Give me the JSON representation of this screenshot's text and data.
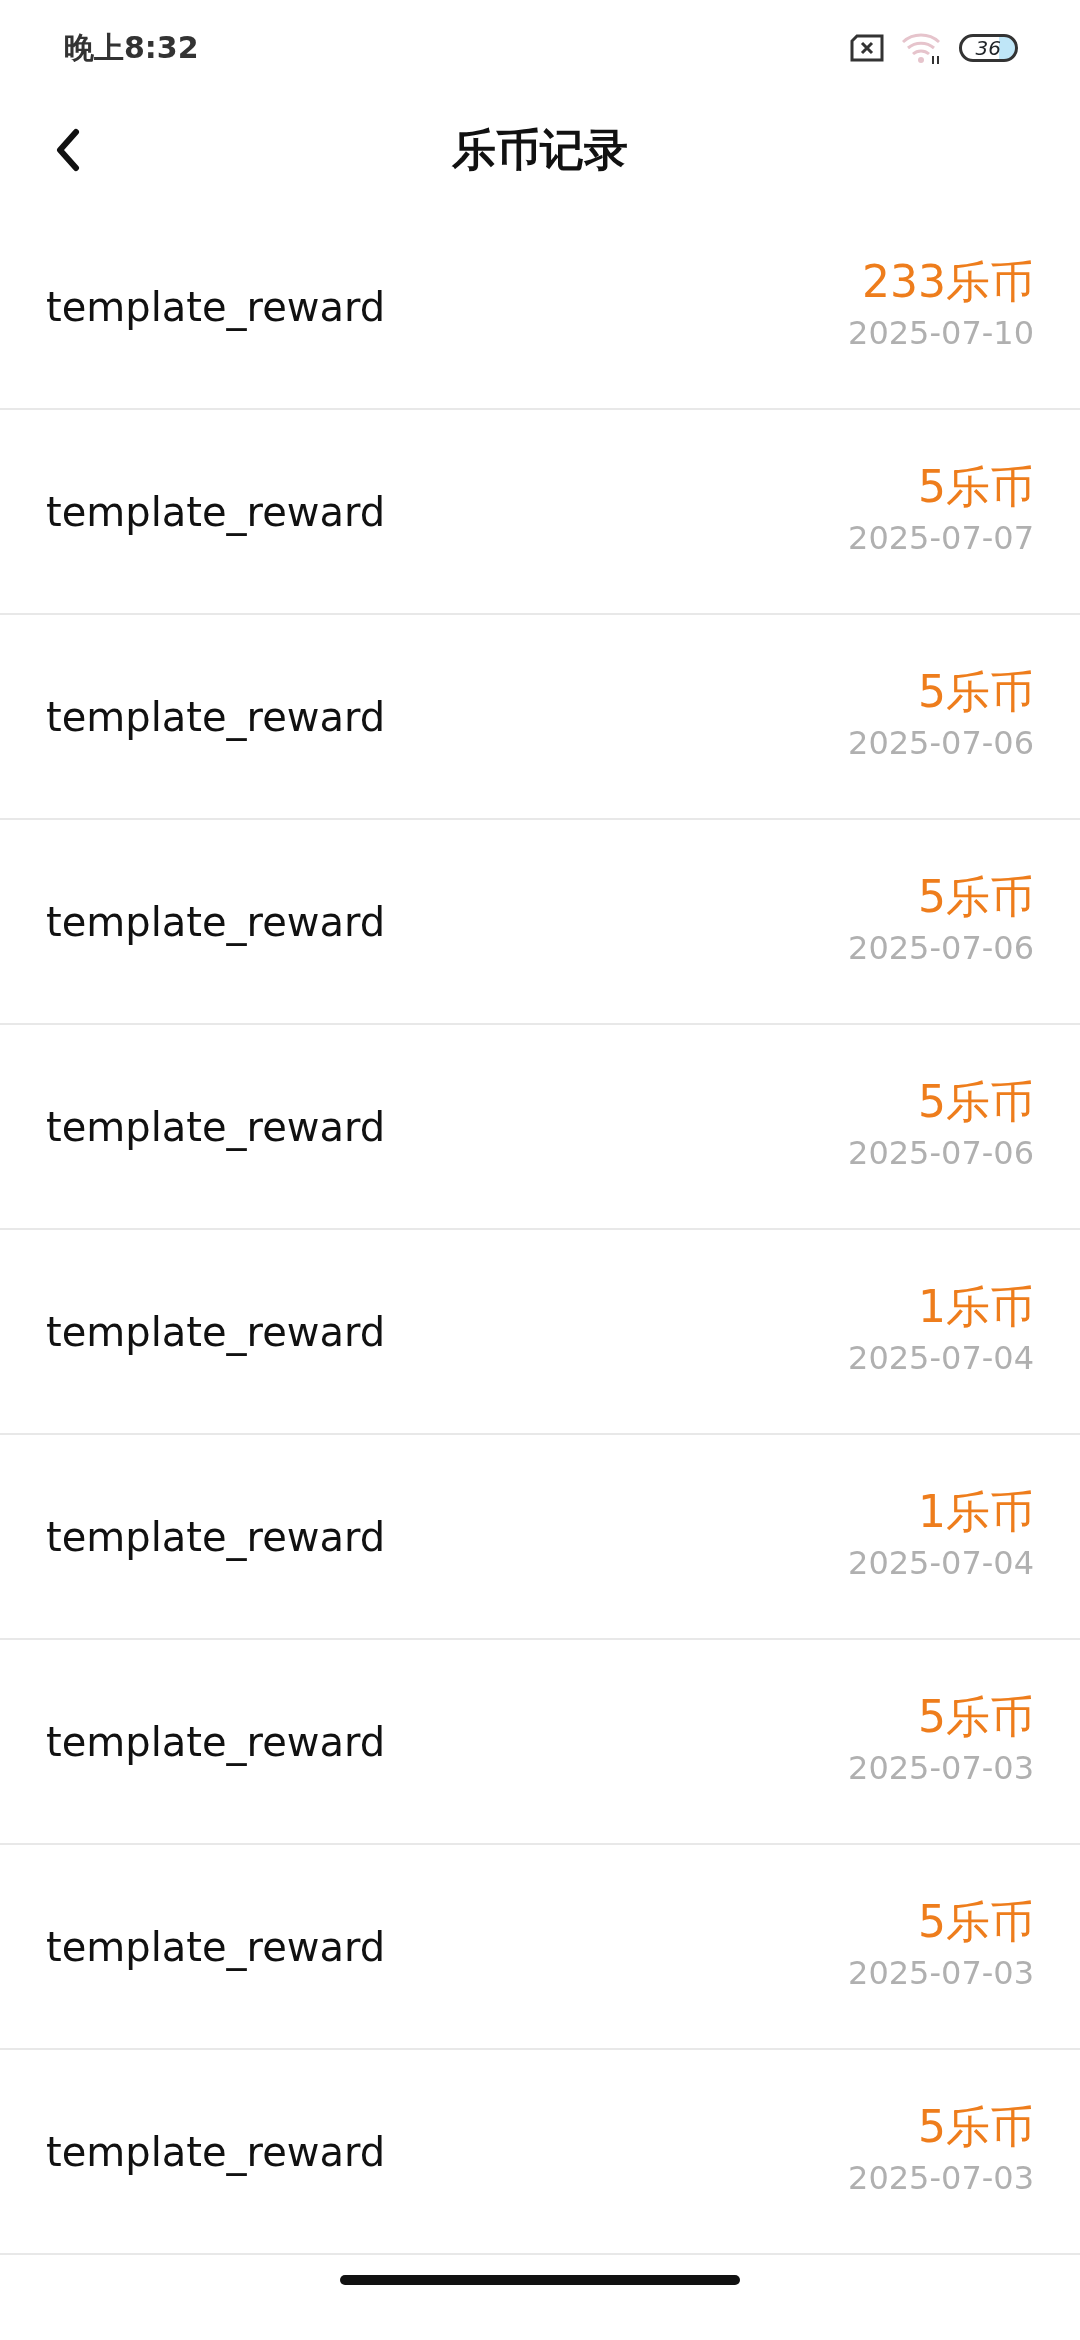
{
  "status_bar": {
    "time": "晚上8:32",
    "battery": "36"
  },
  "header": {
    "title": "乐币记录"
  },
  "records": [
    {
      "name": "template_reward",
      "amount": "233乐币",
      "date": "2025-07-10"
    },
    {
      "name": "template_reward",
      "amount": "5乐币",
      "date": "2025-07-07"
    },
    {
      "name": "template_reward",
      "amount": "5乐币",
      "date": "2025-07-06"
    },
    {
      "name": "template_reward",
      "amount": "5乐币",
      "date": "2025-07-06"
    },
    {
      "name": "template_reward",
      "amount": "5乐币",
      "date": "2025-07-06"
    },
    {
      "name": "template_reward",
      "amount": "1乐币",
      "date": "2025-07-04"
    },
    {
      "name": "template_reward",
      "amount": "1乐币",
      "date": "2025-07-04"
    },
    {
      "name": "template_reward",
      "amount": "5乐币",
      "date": "2025-07-03"
    },
    {
      "name": "template_reward",
      "amount": "5乐币",
      "date": "2025-07-03"
    },
    {
      "name": "template_reward",
      "amount": "5乐币",
      "date": "2025-07-03"
    }
  ]
}
